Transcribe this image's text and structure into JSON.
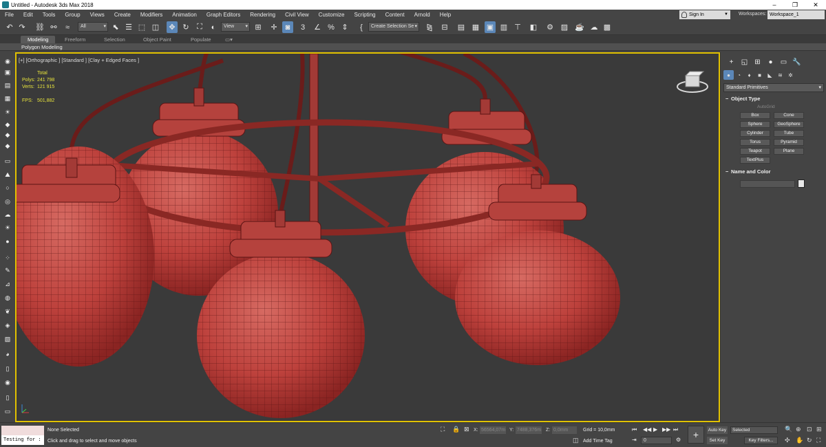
{
  "window": {
    "title": "Untitled - Autodesk 3ds Max 2018",
    "minimize": "–",
    "maximize": "❐",
    "close": "✕"
  },
  "menu": [
    "File",
    "Edit",
    "Tools",
    "Group",
    "Views",
    "Create",
    "Modifiers",
    "Animation",
    "Graph Editors",
    "Rendering",
    "Civil View",
    "Customize",
    "Scripting",
    "Content",
    "Arnold",
    "Help"
  ],
  "signin": {
    "label": "Sign In"
  },
  "workspaces": {
    "label": "Workspaces:",
    "value": "Workspace_1"
  },
  "toolbar": {
    "selection_filter": "All",
    "ref_coord": "View",
    "named_selection": "Create Selection Se",
    "angle_snap_label": "3"
  },
  "ribbon": {
    "tabs": [
      "Modeling",
      "Freeform",
      "Selection",
      "Object Paint",
      "Populate"
    ],
    "active_tab": "Modeling",
    "sub_label": "Polygon Modeling"
  },
  "viewport": {
    "label": "[+] [Orthographic ] [Standard ] [Clay + Edged Faces ]",
    "stats": {
      "total_label": "Total",
      "polys_label": "Polys:",
      "polys_value": "241 798",
      "verts_label": "Verts:",
      "verts_value": "121 915",
      "fps_label": "FPS:",
      "fps_value": "501,882"
    },
    "colors": {
      "model": "#c0453f",
      "wire": "#5a1414",
      "background": "#3a3a3a",
      "active_border": "#e2c200"
    }
  },
  "command_panel": {
    "category_dropdown": "Standard Primitives",
    "object_type_title": "Object Type",
    "autogrid_label": "AutoGrid",
    "primitives": [
      "Box",
      "Cone",
      "Sphere",
      "GeoSphere",
      "Cylinder",
      "Tube",
      "Torus",
      "Pyramid",
      "Teapot",
      "Plane",
      "TextPlus"
    ],
    "name_color_title": "Name and Color"
  },
  "statusbar": {
    "script_input": "Testing for :",
    "selection_status": "None Selected",
    "prompt": "Click and drag to select and move objects",
    "x_label": "X:",
    "x_value": "56564,07m",
    "y_label": "Y:",
    "y_value": "7488,376m",
    "z_label": "Z:",
    "z_value": "0,0mm",
    "grid": "Grid = 10,0mm",
    "add_time_tag": "Add Time Tag",
    "frame": "0",
    "auto_key": "Auto Key",
    "set_key": "Set Key",
    "selected_dropdown": "Selected",
    "key_filters": "Key Filters..."
  }
}
